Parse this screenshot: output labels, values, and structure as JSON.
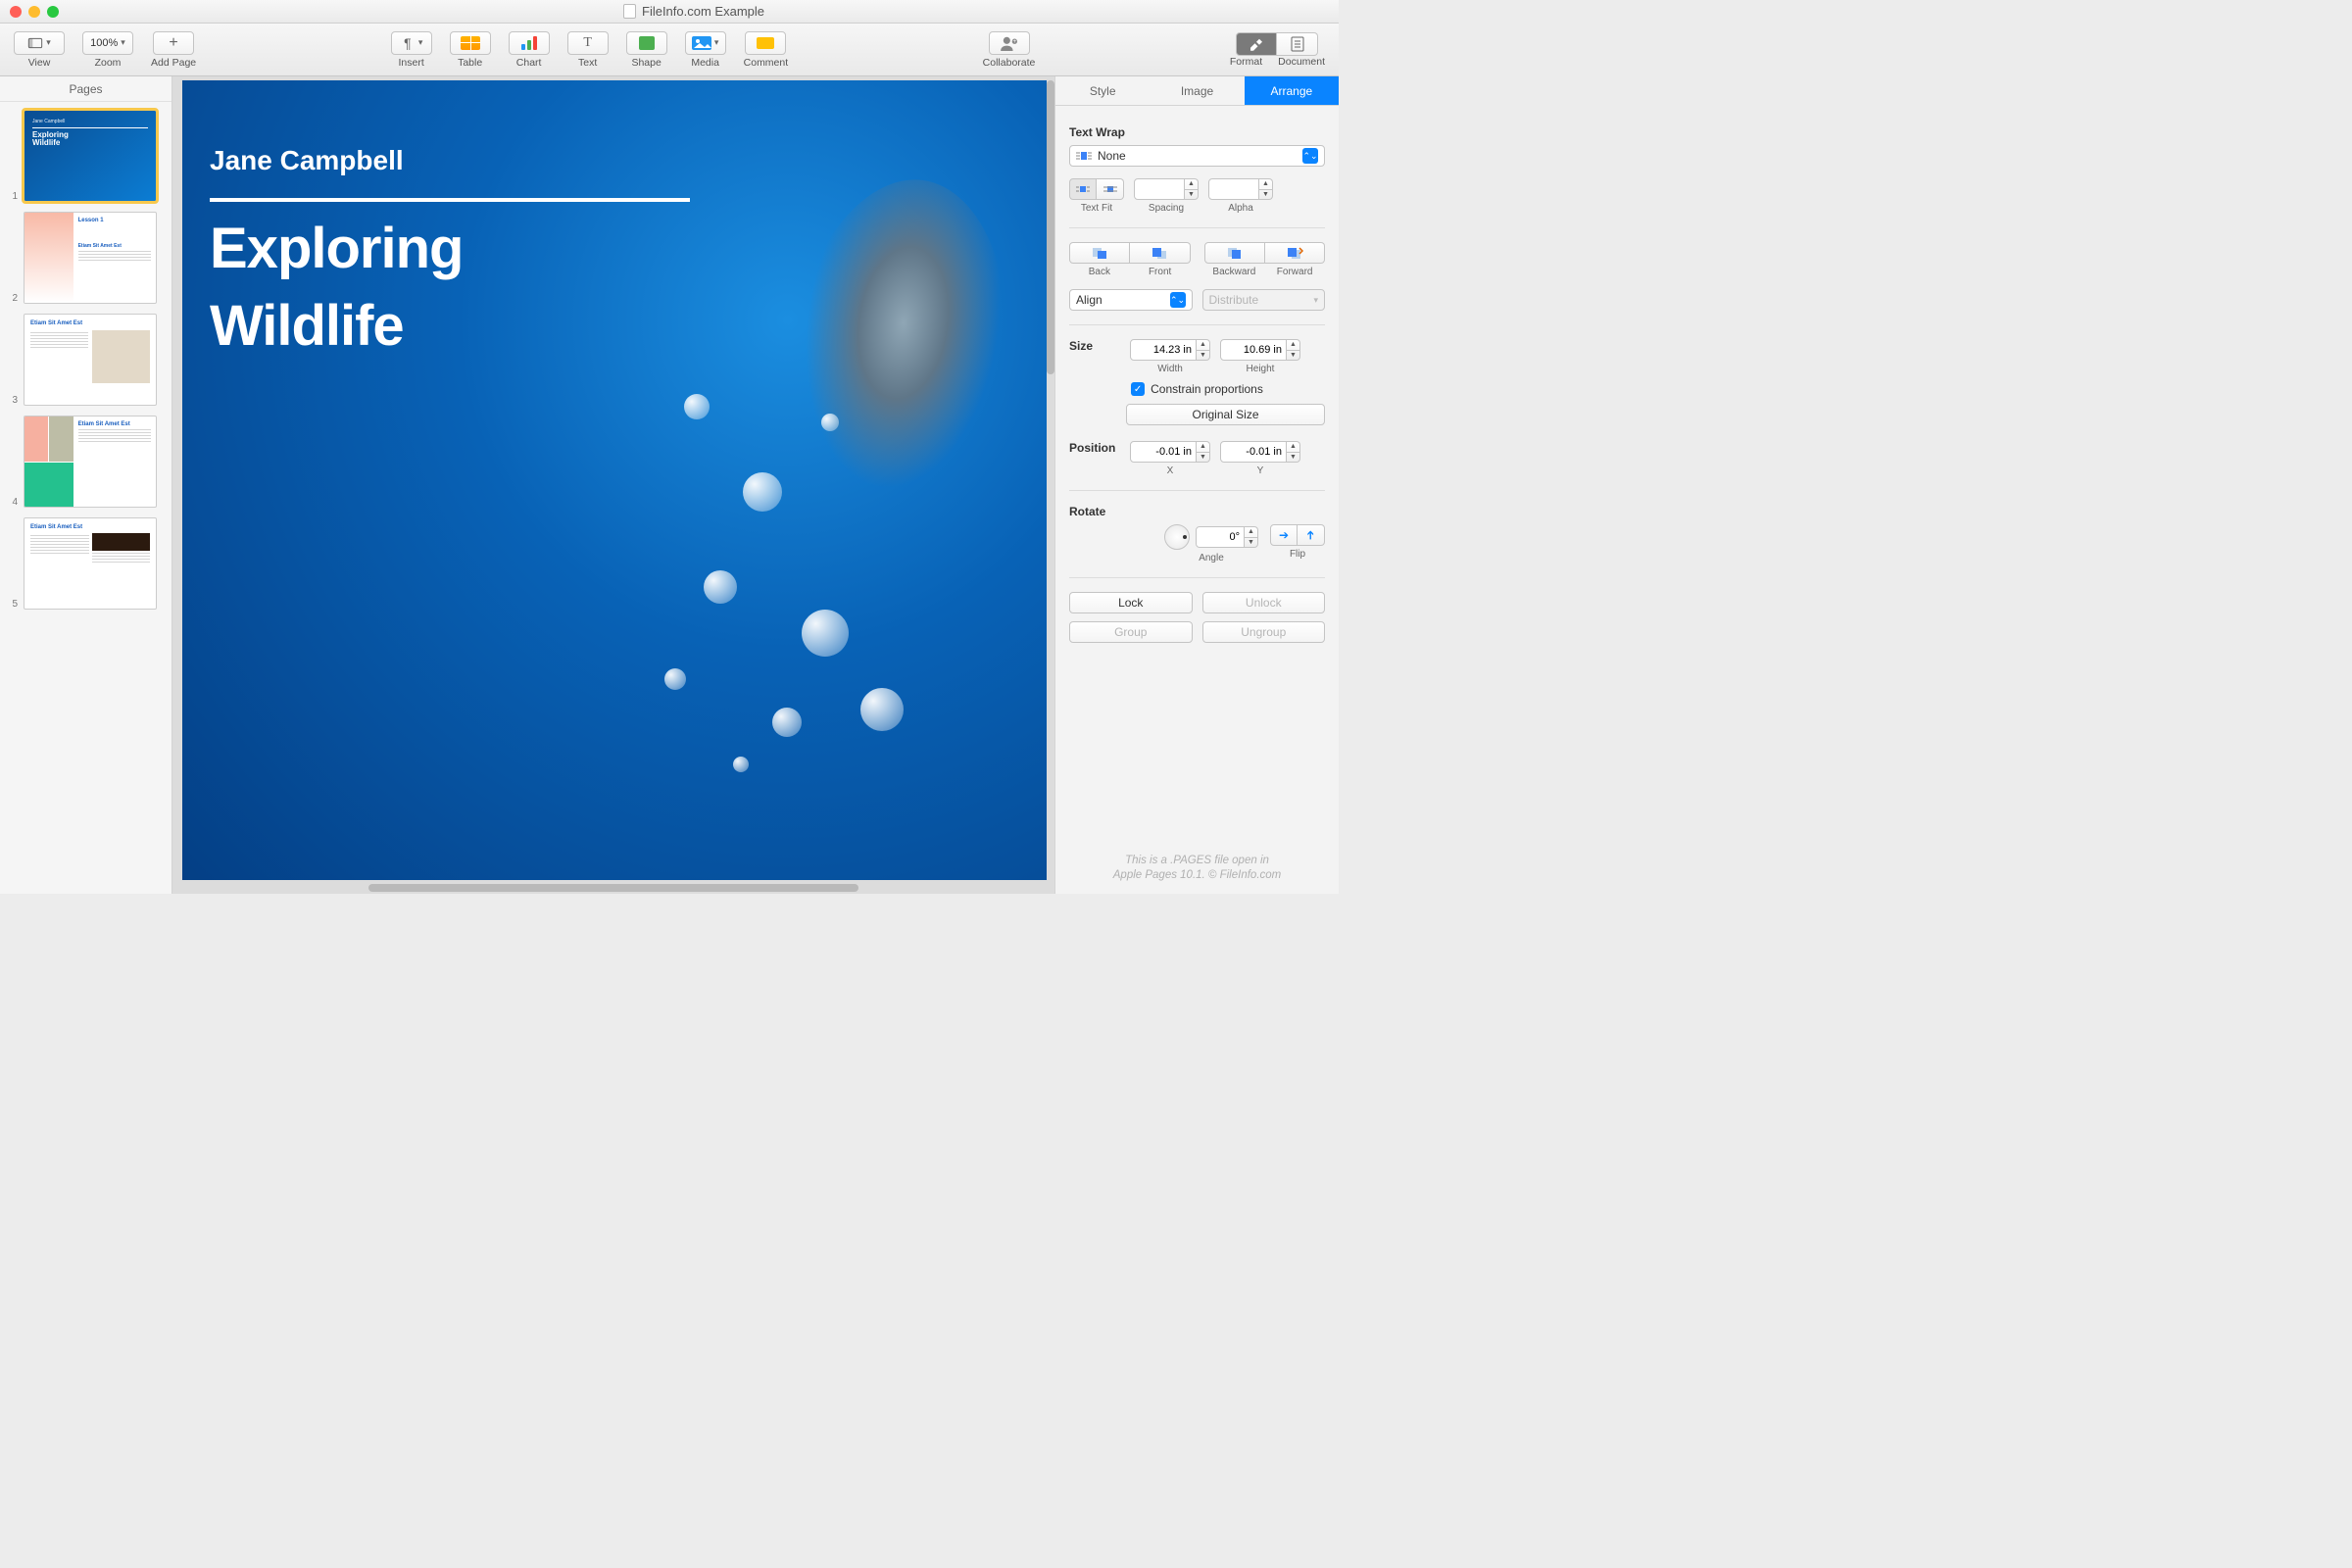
{
  "window": {
    "title": "FileInfo.com Example"
  },
  "toolbar": {
    "view": "View",
    "zoom_label": "Zoom",
    "zoom_value": "100%",
    "add_page": "Add Page",
    "insert": "Insert",
    "table": "Table",
    "chart": "Chart",
    "text": "Text",
    "shape": "Shape",
    "media": "Media",
    "comment": "Comment",
    "collaborate": "Collaborate",
    "format": "Format",
    "document": "Document"
  },
  "sidebar": {
    "title": "Pages",
    "pages": [
      {
        "num": "1",
        "kind": "cover",
        "author": "Jane Campbell",
        "title": "Exploring\nWildlife"
      },
      {
        "num": "2",
        "kind": "lesson",
        "heading": "Lesson 1",
        "sub": "Etiam Sit Amet Est"
      },
      {
        "num": "3",
        "kind": "spread",
        "heading": "Etiam Sit Amet Est"
      },
      {
        "num": "4",
        "kind": "gallery",
        "heading": "Etiam Sit Amet Est"
      },
      {
        "num": "5",
        "kind": "article",
        "heading": "Etiam Sit Amet Est"
      }
    ]
  },
  "canvas": {
    "author": "Jane Campbell",
    "title1": "Exploring",
    "title2": "Wildlife"
  },
  "inspector": {
    "tabs": {
      "style": "Style",
      "image": "Image",
      "arrange": "Arrange",
      "active": "arrange"
    },
    "text_wrap": {
      "label": "Text Wrap",
      "value": "None",
      "text_fit": "Text Fit",
      "spacing": "Spacing",
      "alpha": "Alpha",
      "spacing_value": "",
      "alpha_value": ""
    },
    "stack": {
      "back": "Back",
      "front": "Front",
      "backward": "Backward",
      "forward": "Forward"
    },
    "align_label": "Align",
    "distribute_label": "Distribute",
    "size": {
      "label": "Size",
      "width_label": "Width",
      "height_label": "Height",
      "width": "14.23 in",
      "height": "10.69 in",
      "constrain": "Constrain proportions",
      "original": "Original Size"
    },
    "position": {
      "label": "Position",
      "x_label": "X",
      "y_label": "Y",
      "x": "-0.01 in",
      "y": "-0.01 in"
    },
    "rotate": {
      "label": "Rotate",
      "angle_label": "Angle",
      "flip_label": "Flip",
      "angle": "0°"
    },
    "lock": "Lock",
    "unlock": "Unlock",
    "group": "Group",
    "ungroup": "Ungroup"
  },
  "footer": {
    "line1": "This is a .PAGES file open in",
    "line2": "Apple Pages 10.1. © FileInfo.com"
  }
}
